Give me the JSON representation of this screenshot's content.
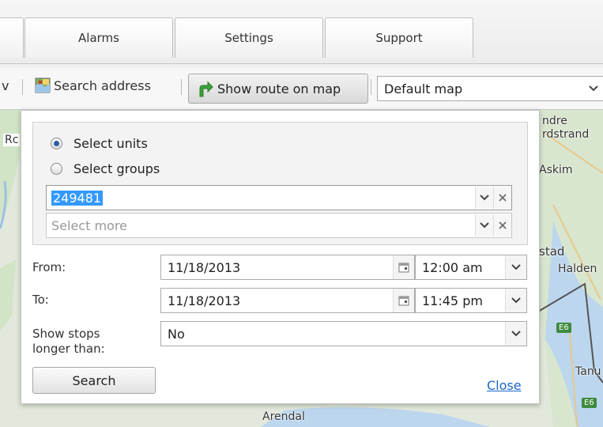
{
  "tabs": [
    {
      "label": ""
    },
    {
      "label": "Alarms"
    },
    {
      "label": "Settings"
    },
    {
      "label": "Support"
    }
  ],
  "toolbar": {
    "partial_left": "v",
    "search_address": "Search address",
    "show_route": "Show route on map",
    "map_type": "Default map"
  },
  "map": {
    "labels": [
      "ndre",
      "rdstrand",
      "Askim",
      "stad",
      "Halden",
      "Tanu",
      "Arendal",
      "Rc"
    ],
    "badges": [
      "E6",
      "E6"
    ]
  },
  "dialog": {
    "radio_units": "Select units",
    "radio_groups": "Select groups",
    "unit_value": "249481",
    "select_more_placeholder": "Select more",
    "from_label": "From:",
    "from_date": "11/18/2013",
    "from_time": "12:00 am",
    "to_label": "To:",
    "to_date": "11/18/2013",
    "to_time": "11:45 pm",
    "stops_label_1": "Show stops",
    "stops_label_2": "longer than:",
    "stops_value": "No",
    "search_button": "Search",
    "close_link": "Close"
  },
  "colors": {
    "accent_selection": "#3399ff",
    "link": "#1a66c9",
    "route_icon": "#3aa33a"
  }
}
